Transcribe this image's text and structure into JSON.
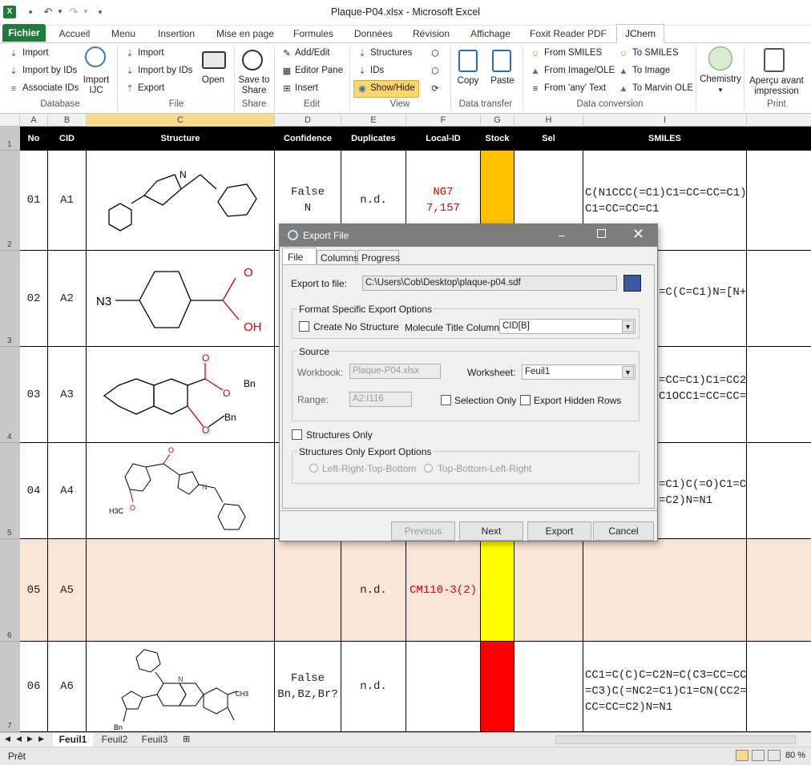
{
  "window": {
    "title": "Plaque-P04.xlsx  -  Microsoft Excel"
  },
  "ribbon_tabs": [
    "Fichier",
    "Accueil",
    "Menu",
    "Insertion",
    "Mise en page",
    "Formules",
    "Données",
    "Révision",
    "Affichage",
    "Foxit Reader PDF",
    "JChem"
  ],
  "ribbon": {
    "database": {
      "import": "Import",
      "import_by_ids": "Import by IDs",
      "associate_ids": "Associate IDs",
      "import_ijc": "Import\nIJC",
      "group": "Database"
    },
    "file": {
      "import": "Import",
      "import_by_ids": "Import by IDs",
      "export": "Export",
      "open": "Open",
      "group": "File"
    },
    "share": {
      "save_to_share": "Save to\nShare",
      "group": "Share"
    },
    "edit": {
      "add_edit": "Add/Edit",
      "editor_pane": "Editor Pane",
      "insert": "Insert",
      "group": "Edit"
    },
    "view": {
      "structures": "Structures",
      "ids": "IDs",
      "show_hide": "Show/Hide",
      "group": "View"
    },
    "data_transfer": {
      "copy": "Copy",
      "paste": "Paste",
      "group": "Data transfer"
    },
    "data_conversion": {
      "from_smiles": "From SMILES",
      "from_image_ole": "From Image/OLE",
      "from_any_text": "From 'any' Text",
      "to_smiles": "To SMILES",
      "to_image": "To Image",
      "to_marvin_ole": "To Marvin OLE",
      "group": "Data conversion"
    },
    "chemistry": {
      "label": "Chemistry"
    },
    "print": {
      "apercu": "Aperçu avant\nimpression",
      "group": "Print"
    }
  },
  "columns": [
    "A",
    "B",
    "C",
    "D",
    "E",
    "F",
    "G",
    "H",
    "I"
  ],
  "header_row": {
    "no": "No",
    "cid": "CID",
    "structure": "Structure",
    "confidence": "Confidence",
    "duplicates": "Duplicates",
    "local_id": "Local-ID",
    "stock": "Stock",
    "sel": "Sel",
    "smiles": "SMILES"
  },
  "rows": [
    {
      "rownum": "2",
      "no": "01",
      "cid": "A1",
      "confidence": "False\nN",
      "duplicates": "n.d.",
      "local_id": "NG7\n7,157",
      "stock_color": "#ffc000",
      "smiles": "C(N1CCC(=C1)C1=CC=CC=C1)\nC1=CC=CC=C1"
    },
    {
      "rownum": "3",
      "no": "02",
      "cid": "A2",
      "confidence": "",
      "duplicates": "",
      "local_id": "",
      "stock_color": "",
      "smiles": "=C(C=C1)N=[N+"
    },
    {
      "rownum": "4",
      "no": "03",
      "cid": "A3",
      "confidence": "",
      "duplicates": "",
      "local_id": "",
      "stock_color": "",
      "smiles": "=CC=C1)C1=CC2\nC1OCC1=CC=CC="
    },
    {
      "rownum": "5",
      "no": "04",
      "cid": "A4",
      "confidence": "",
      "duplicates": "",
      "local_id": "",
      "stock_color": "",
      "smiles": "=C1)C(=O)C1=C\n=C2)N=N1"
    },
    {
      "rownum": "6",
      "no": "05",
      "cid": "A5",
      "confidence": "",
      "duplicates": "n.d.",
      "local_id": "CM110-3(2)",
      "stock_color": "#ffff00",
      "smiles": ""
    },
    {
      "rownum": "7",
      "no": "06",
      "cid": "A6",
      "confidence": "False\nBn,Bz,Br?",
      "duplicates": "n.d.",
      "local_id": "",
      "stock_color": "#ff0000",
      "smiles": "CC1=C(C)C=C2N=C(C3=CC=CC\n=C3)C(=NC2=C1)C1=CN(CC2=\nCC=CC=C2)N=N1"
    }
  ],
  "structures": {
    "a2_n3": "N3",
    "a2_o": "O",
    "a2_oh": "OH",
    "a3_o1": "O",
    "a3_o2": "O",
    "a3_bn1": "Bn",
    "a3_bn2": "Bn",
    "a4_o": "O",
    "a4_meo": "H3C",
    "a4_meo_o": "O",
    "a4_n": "N",
    "a6_bn": "Bn",
    "a6_n": "N",
    "a6_me": "CH3"
  },
  "dialog": {
    "title": "Export File",
    "tabs": [
      "File",
      "Columns",
      "Progress"
    ],
    "export_to_file_label": "Export to file:",
    "export_path": "C:\\Users\\Cob\\Desktop\\plaque-p04.sdf",
    "format_group": "Format Specific Export Options",
    "create_no_structure": "Create No Structure",
    "molecule_title_label": "Molecule Title Column:",
    "molecule_title_value": "CID[B]",
    "source_group": "Source",
    "workbook_label": "Workbook:",
    "workbook_value": "Plaque-P04.xlsx",
    "worksheet_label": "Worksheet:",
    "worksheet_value": "Feuil1",
    "range_label": "Range:",
    "range_value": "A2:I116",
    "selection_only": "Selection Only",
    "export_hidden_rows": "Export Hidden Rows",
    "structures_only": "Structures Only",
    "structures_only_group": "Structures Only Export Options",
    "lrtb": "Left-Right-Top-Bottom",
    "tblr": "Top-Bottom-Left-Right",
    "btn_previous": "Previous",
    "btn_next": "Next",
    "btn_export": "Export",
    "btn_cancel": "Cancel"
  },
  "sheets": [
    "Feuil1",
    "Feuil2",
    "Feuil3"
  ],
  "status": {
    "ready": "Prêt",
    "zoom": "80 %"
  }
}
